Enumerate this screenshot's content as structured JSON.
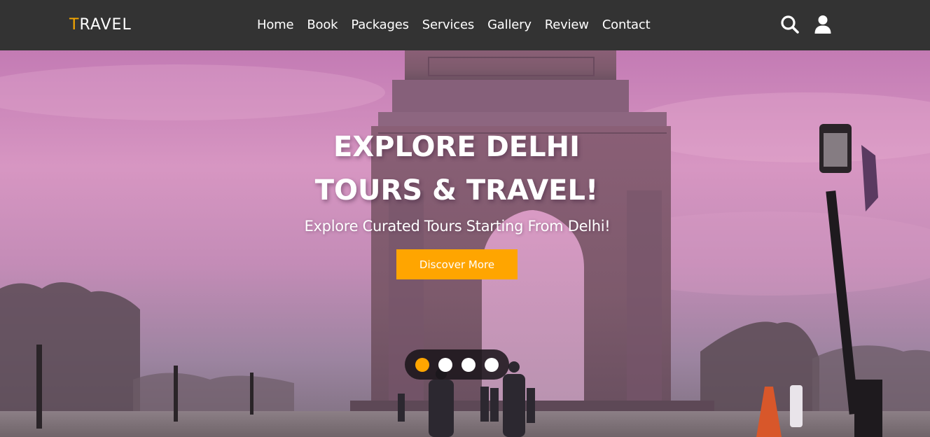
{
  "brand": {
    "first_letter": "T",
    "rest": "RAVEL"
  },
  "nav": {
    "items": [
      "Home",
      "Book",
      "Packages",
      "Services",
      "Gallery",
      "Review",
      "Contact"
    ]
  },
  "icons": {
    "search": "search-icon",
    "user": "user-icon"
  },
  "hero": {
    "title_line1": "EXPLORE DELHI",
    "title_line2": "TOURS & TRAVEL!",
    "subtitle": "Explore Curated Tours Starting From Delhi!",
    "cta_label": "Discover More",
    "slide_count": 4,
    "active_slide": 1
  },
  "colors": {
    "header_bg": "#333333",
    "accent": "#ffa500",
    "text": "#ffffff"
  }
}
